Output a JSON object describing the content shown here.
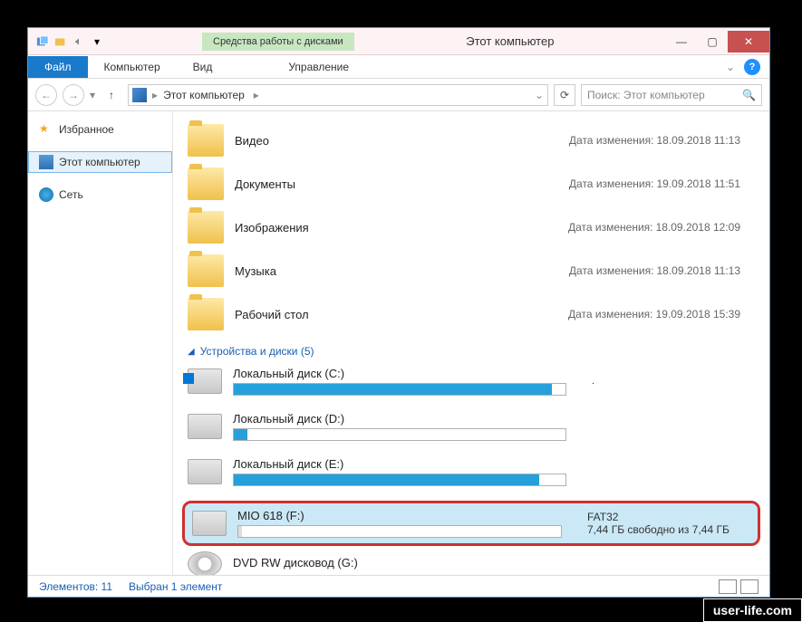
{
  "window": {
    "context_tab": "Средства работы с дисками",
    "title": "Этот компьютер"
  },
  "ribbon": {
    "file": "Файл",
    "computer": "Компьютер",
    "view": "Вид",
    "manage": "Управление"
  },
  "nav": {
    "up_arrow": "↑",
    "location": "Этот компьютер",
    "search_placeholder": "Поиск: Этот компьютер"
  },
  "sidebar": {
    "favorites": "Избранное",
    "this_pc": "Этот компьютер",
    "network": "Сеть"
  },
  "folders": [
    {
      "name": "Видео",
      "date_label": "Дата изменения:",
      "date": "18.09.2018 11:13"
    },
    {
      "name": "Документы",
      "date_label": "Дата изменения:",
      "date": "19.09.2018 11:51"
    },
    {
      "name": "Изображения",
      "date_label": "Дата изменения:",
      "date": "18.09.2018 12:09"
    },
    {
      "name": "Музыка",
      "date_label": "Дата изменения:",
      "date": "18.09.2018 11:13"
    },
    {
      "name": "Рабочий стол",
      "date_label": "Дата изменения:",
      "date": "19.09.2018 15:39"
    }
  ],
  "group": {
    "label": "Устройства и диски (5)"
  },
  "drives": {
    "c": {
      "name": "Локальный диск (C:)",
      "fill": 96,
      "meta": "."
    },
    "d": {
      "name": "Локальный диск (D:)",
      "fill": 4
    },
    "e": {
      "name": "Локальный диск (E:)",
      "fill": 92
    },
    "f": {
      "name": "MIO 618 (F:)",
      "fs": "FAT32",
      "free": "7,44 ГБ свободно из 7,44 ГБ",
      "fill": 1
    },
    "g": {
      "name": "DVD RW дисковод (G:)"
    }
  },
  "status": {
    "items": "Элементов: 11",
    "selected": "Выбран 1 элемент"
  },
  "watermark": "user-life.com"
}
